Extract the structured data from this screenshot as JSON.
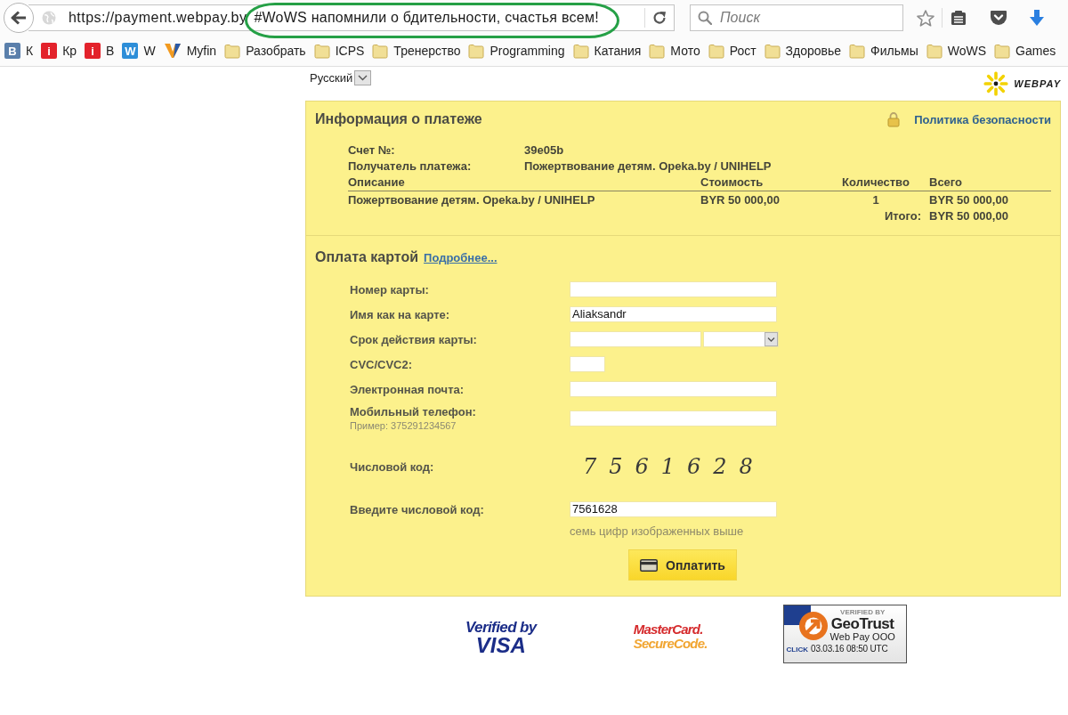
{
  "browser": {
    "url": {
      "host": "https://payment.webpay.by",
      "fragment": "#WoWS напомнили о бдительности, счастья всем!",
      "highlighted": true
    },
    "search": {
      "placeholder": "Поиск"
    },
    "bookmarks": [
      {
        "kind": "vk",
        "glyph": "B",
        "label": "К"
      },
      {
        "kind": "red",
        "glyph": "i",
        "label": "Кр"
      },
      {
        "kind": "red",
        "glyph": "i",
        "label": "В"
      },
      {
        "kind": "w",
        "glyph": "W",
        "label": "W"
      },
      {
        "kind": "myfin",
        "label": "Myfin"
      },
      {
        "kind": "folder",
        "label": "Разобрать"
      },
      {
        "kind": "folder",
        "label": "ICPS"
      },
      {
        "kind": "folder",
        "label": "Тренерство"
      },
      {
        "kind": "folder",
        "label": "Programming"
      },
      {
        "kind": "folder",
        "label": "Катания"
      },
      {
        "kind": "folder",
        "label": "Мото"
      },
      {
        "kind": "folder",
        "label": "Рост"
      },
      {
        "kind": "folder",
        "label": "Здоровье"
      },
      {
        "kind": "folder",
        "label": "Фильмы"
      },
      {
        "kind": "folder",
        "label": "WoWS"
      },
      {
        "kind": "folder",
        "label": "Games"
      }
    ]
  },
  "header": {
    "language": "Русский",
    "logo": "WEBPAY"
  },
  "payment_info": {
    "title": "Информация о платеже",
    "security_link": "Политика безопасности",
    "details": [
      {
        "label": "Счет №:",
        "value": "39e05b"
      },
      {
        "label": "Получатель платежа:",
        "value": "Пожертвование детям. Opeka.by / UNIHELP"
      }
    ],
    "table": {
      "columns": [
        "Описание",
        "Стоимость",
        "Количество",
        "Всего"
      ],
      "rows": [
        [
          "Пожертвование детям. Opeka.by / UNIHELP",
          "BYR 50 000,00",
          "1",
          "BYR 50 000,00"
        ]
      ],
      "total_label": "Итого:",
      "total_value": "BYR 50 000,00"
    }
  },
  "card_payment": {
    "title": "Оплата картой",
    "more_link": "Подробнее...",
    "fields": [
      {
        "kind": "text",
        "label": "Номер карты:"
      },
      {
        "kind": "text",
        "label": "Имя как на карте:",
        "value": "Aliaksandr"
      },
      {
        "kind": "expiry",
        "label": "Срок действия карты:"
      },
      {
        "kind": "short",
        "label": "CVC/CVC2:"
      },
      {
        "kind": "text",
        "label": "Электронная почта:"
      },
      {
        "kind": "text",
        "label": "Мобильный телефон:",
        "example": "Пример: 375291234567"
      },
      {
        "kind": "captcha",
        "label": "Числовой код:",
        "code": "7561628"
      },
      {
        "kind": "text",
        "label": "Введите числовой код:",
        "value": "7561628",
        "hint": "семь цифр изображенных выше"
      }
    ],
    "submit": "Оплатить"
  },
  "trust_badges": [
    {
      "kind": "visa",
      "lines": [
        "Verified by",
        "VISA"
      ]
    },
    {
      "kind": "mastercard",
      "lines": [
        "MasterCard.",
        "SecureCode."
      ]
    },
    {
      "kind": "geotrust",
      "verified": "VERIFIED BY",
      "brand": "GeoTrust",
      "company": "Web Pay OOO",
      "click": "CLICK",
      "timestamp": "03.03.16 08:50 UTC"
    }
  ]
}
